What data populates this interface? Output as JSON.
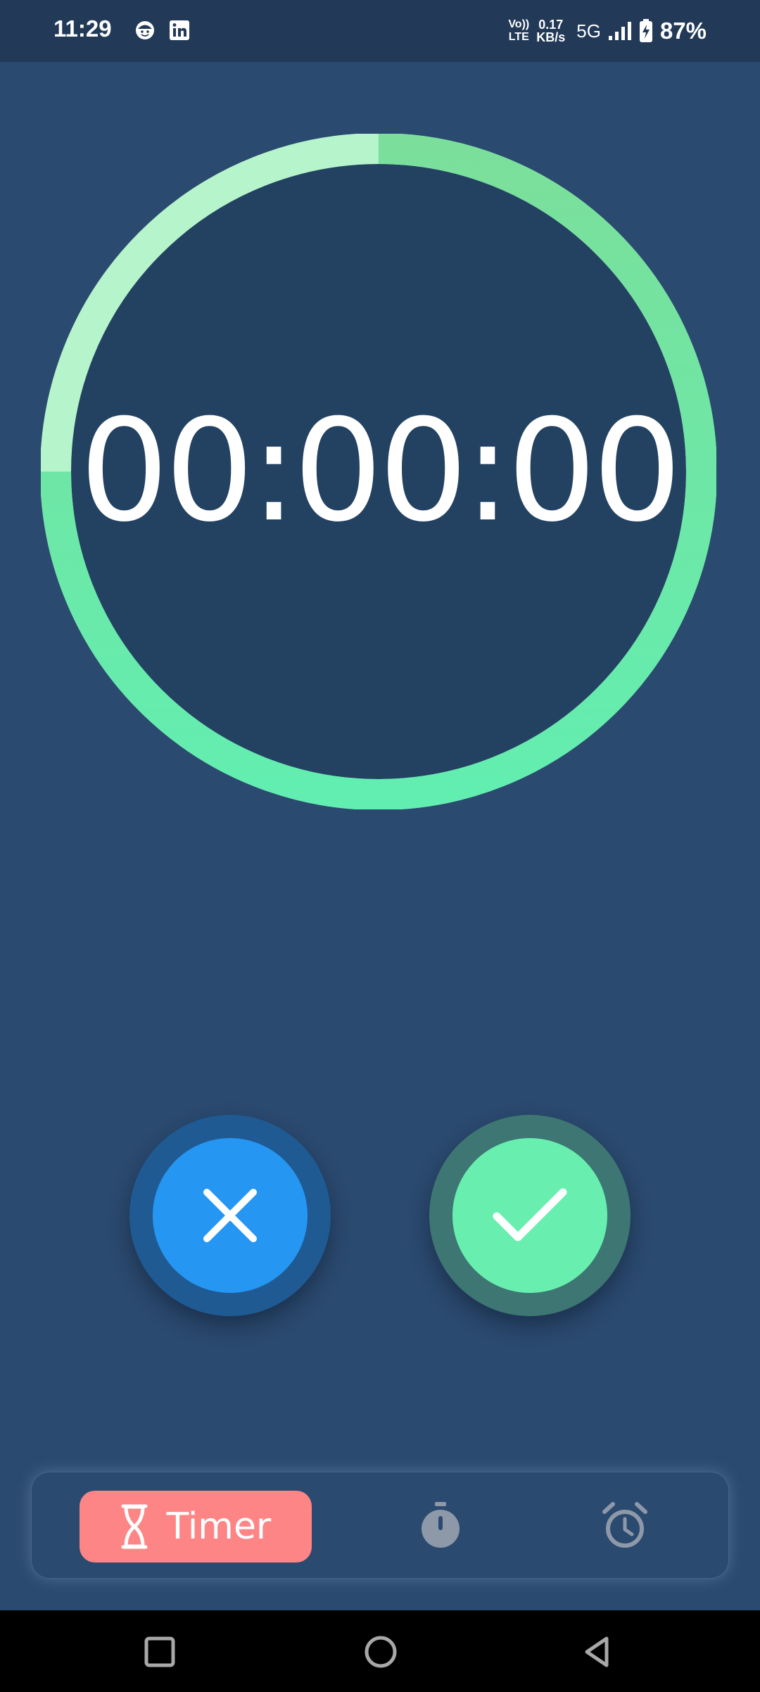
{
  "status_bar": {
    "time": "11:29",
    "volte_top": "Vo))",
    "volte_bottom": "LTE",
    "speed_value": "0.17",
    "speed_unit": "KB/s",
    "network_type": "5G",
    "battery_percent": "87%",
    "icons": [
      "face-app-icon",
      "linkedin-icon",
      "signal-icon",
      "battery-charging-icon"
    ]
  },
  "timer": {
    "display": "00:00:00",
    "ring_colors": {
      "track": "#b6f5cb",
      "progress_start": "#7bdf9b",
      "progress_end": "#62eeb0",
      "face": "#234262"
    }
  },
  "actions": {
    "cancel_icon": "close-icon",
    "confirm_icon": "check-icon",
    "cancel_color": "#2596f2",
    "confirm_color": "#68efaf"
  },
  "bottom_nav": {
    "tabs": [
      {
        "label": "Timer",
        "icon": "hourglass-icon",
        "active": true,
        "color": "#fe8585"
      },
      {
        "label": "",
        "icon": "stopwatch-icon",
        "active": false
      },
      {
        "label": "",
        "icon": "alarm-clock-icon",
        "active": false
      }
    ]
  },
  "system_nav": {
    "buttons": [
      "recents-icon",
      "home-icon",
      "back-icon"
    ]
  },
  "colors": {
    "background": "#2b4a6f",
    "status_bar": "#223a58",
    "inactive_icon": "#8d99a9"
  }
}
